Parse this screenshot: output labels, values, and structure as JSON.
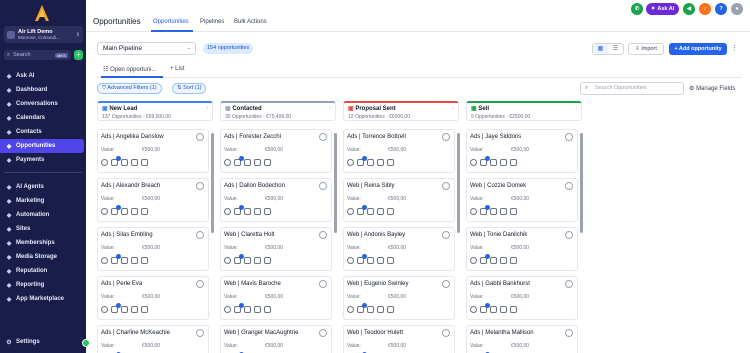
{
  "sidebar": {
    "account": {
      "name": "Air Lift Demo",
      "location": "Monrose, Comundi..."
    },
    "search": {
      "placeholder": "Search",
      "shortcut": "ctrl K"
    },
    "nav_top": [
      {
        "label": "Ask AI",
        "icon": "sparkle-icon"
      },
      {
        "label": "Dashboard",
        "icon": "dashboard-icon"
      },
      {
        "label": "Conversations",
        "icon": "chat-icon"
      },
      {
        "label": "Calendars",
        "icon": "calendar-icon"
      },
      {
        "label": "Contacts",
        "icon": "contacts-icon"
      },
      {
        "label": "Opportunities",
        "icon": "funnel-icon",
        "active": true
      },
      {
        "label": "Payments",
        "icon": "payments-icon"
      }
    ],
    "nav_bottom": [
      {
        "label": "AI Agents",
        "icon": "robot-icon"
      },
      {
        "label": "Marketing",
        "icon": "megaphone-icon"
      },
      {
        "label": "Automation",
        "icon": "automation-icon"
      },
      {
        "label": "Sites",
        "icon": "globe-icon"
      },
      {
        "label": "Memberships",
        "icon": "membership-icon"
      },
      {
        "label": "Media Storage",
        "icon": "storage-icon"
      },
      {
        "label": "Reputation",
        "icon": "star-icon"
      },
      {
        "label": "Reporting",
        "icon": "chart-icon"
      },
      {
        "label": "App Marketplace",
        "icon": "grid-icon"
      }
    ],
    "settings": "Settings"
  },
  "header": {
    "title": "Opportunities",
    "tabs": [
      "Opportunities",
      "Pipelines",
      "Bulk Actions"
    ],
    "ask_ai": "Ask AI"
  },
  "toolbar": {
    "pipeline": "Main Pipeline",
    "count": "154 opportunities",
    "import": "Import",
    "add": "Add opportunity",
    "subtabs": [
      "Open opportuni...",
      "+ List"
    ],
    "advanced_filters": "Advanced Filters (1)",
    "sort": "Sort (1)",
    "search_placeholder": "Search Opportunities",
    "manage_fields": "Manage Fields"
  },
  "columns": [
    {
      "title": "New Lead",
      "summary": "137 Opportunities · €69,500,00",
      "accent": "#3b82f6",
      "cards": [
        "Ads | Angelika Danslow",
        "Ads | Alexandr Breach",
        "Ads | Silas Embling",
        "Ads | Perle Eva",
        "Ads | Charline McKeachie"
      ]
    },
    {
      "title": "Contacted",
      "summary": "30 Opportunities · €75,499,00",
      "accent": "#94a3b8",
      "cards": [
        "Ads | Forester Zecchi",
        "Ads | Dallon Bodechon",
        "Web | Claretta Holt",
        "Web | Mavis Baroche",
        "Web | Granger MacAughtrie"
      ]
    },
    {
      "title": "Proposal Sent",
      "summary": "12 Opportunities · €6000,00",
      "accent": "#ef4444",
      "cards": [
        "Ads | Torrence Bottrell",
        "Web | Reina Sibly",
        "Web | Andonis Bayley",
        "Web | Eugenio Swinley",
        "Web | Teodoor Hulett"
      ]
    },
    {
      "title": "Sell",
      "summary": "5 Opportunities · €2500,00",
      "accent": "#16a34a",
      "cards": [
        "Ads | Jaye Siddons",
        "Web | Cozzie Domek",
        "Web | Tonie Danilchik",
        "Ads | Gabbi Bankhurst",
        "Ads | Melantha Mallison"
      ]
    }
  ],
  "card_value_label": "Value:",
  "card_value": "€500,00",
  "icons": {
    "brand_color": "#1a1d4a",
    "accent": "#2563eb"
  }
}
